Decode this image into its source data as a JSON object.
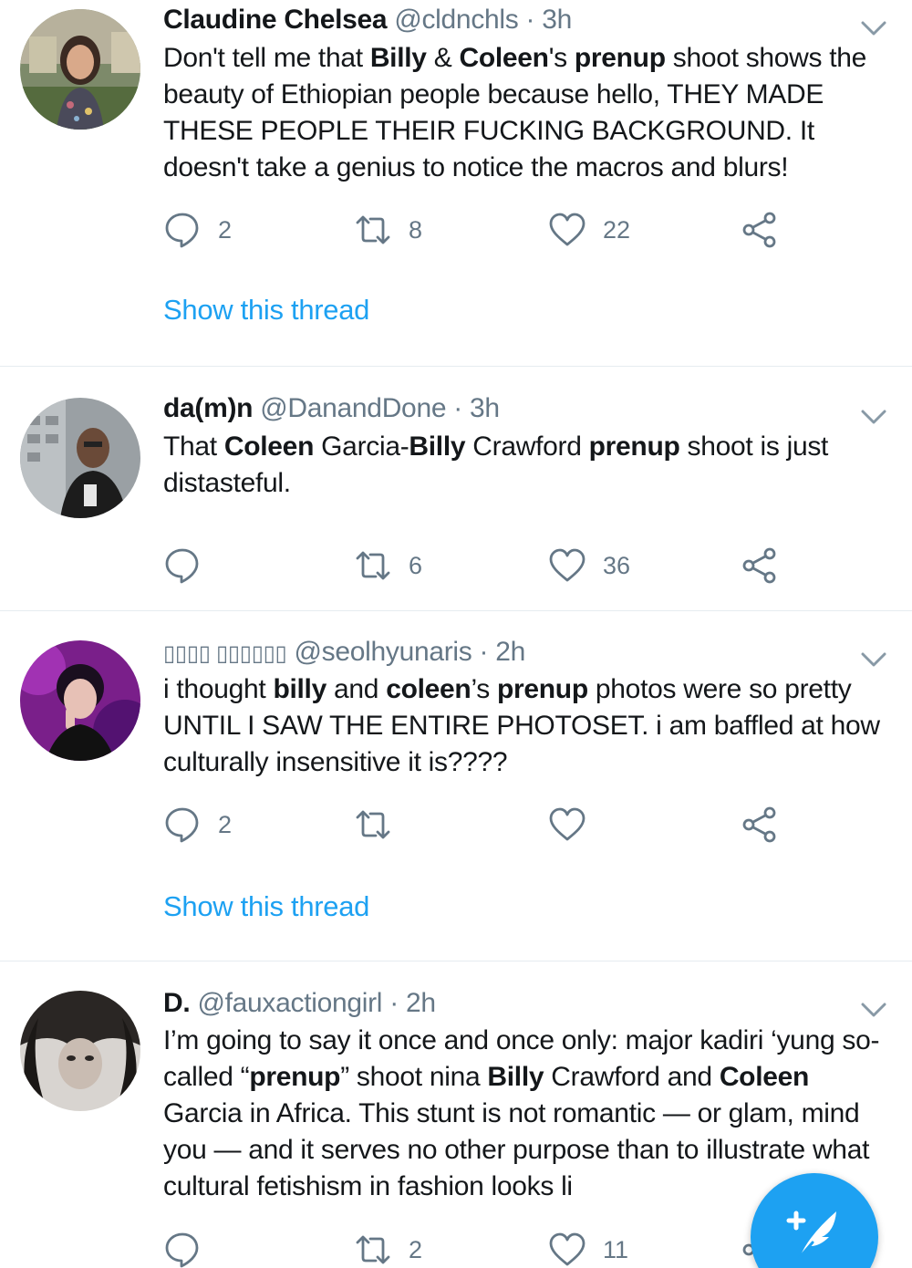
{
  "tweets": [
    {
      "name": "Claudine Chelsea",
      "handle": "@cldnchls",
      "time": "3h",
      "text_html": "Don't tell me that <b>Billy</b> &amp; <b>Coleen</b>'s <b>prenup</b> shoot shows the beauty of Ethiopian people because hello, THEY MADE THESE PEOPLE THEIR FUCKING BACKGROUND. It doesn't take a genius to notice the macros and blurs!",
      "replies": "2",
      "retweets": "8",
      "likes": "22",
      "show_thread": "Show this thread"
    },
    {
      "name": "da(m)n",
      "handle": "@DanandDone",
      "time": "3h",
      "text_html": "That <b>Coleen</b> Garcia-<b>Billy</b> Crawford <b>prenup</b> shoot is just distasteful.",
      "replies": "",
      "retweets": "6",
      "likes": "36"
    },
    {
      "name": "▯▯▯▯ ▯▯▯▯▯▯",
      "handle": "@seolhyunaris",
      "time": "2h",
      "text_html": "i thought <b>billy</b> and <b>coleen</b>’s <b>prenup</b> photos were so pretty UNTIL I SAW THE ENTIRE PHOTOSET. i am baffled at how culturally insensitive it is????",
      "replies": "2",
      "retweets": "",
      "likes": "",
      "show_thread": "Show this thread"
    },
    {
      "name": "D.",
      "handle": "@fauxactiongirl",
      "time": "2h",
      "text_html": "I’m going to say it once and once only: major kadiri ‘yung so-called “<b>prenup</b>” shoot nina <b>Billy</b> Crawford and <b>Coleen</b> Garcia in Africa. This stunt is not romantic — or glam, mind you — and it serves no other purpose than to illustrate what cultural fetishism in fashion looks li",
      "replies": "",
      "retweets": "2",
      "likes": "11"
    }
  ],
  "separator": "·",
  "icons": {
    "reply": "reply-icon",
    "retweet": "retweet-icon",
    "like": "heart-icon",
    "share": "share-icon",
    "menu": "chevron-down-icon",
    "compose": "compose-tweet-icon"
  },
  "colors": {
    "accent": "#1da1f2",
    "secondary_text": "#657786",
    "divider": "#e6ecf0"
  }
}
